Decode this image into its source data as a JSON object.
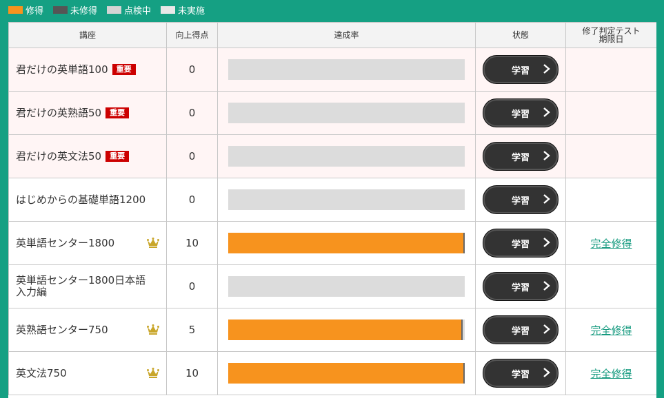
{
  "legend": [
    {
      "label": "修得",
      "color": "#f7931e"
    },
    {
      "label": "未修得",
      "color": "#555555"
    },
    {
      "label": "点検中",
      "color": "#d4d4d4"
    },
    {
      "label": "未実施",
      "color": "#e8e8e8"
    }
  ],
  "table": {
    "headers": {
      "course": "講座",
      "score": "向上得点",
      "progress": "達成率",
      "status": "状態",
      "test_line1": "修了判定テスト",
      "test_line2": "期限日"
    },
    "rows": [
      {
        "course": "君だけの英単語100",
        "badge": "重要",
        "score": "0",
        "progress": 0,
        "button": "学習",
        "test_status": ""
      },
      {
        "course": "君だけの英熟語50",
        "badge": "重要",
        "score": "0",
        "progress": 0,
        "button": "学習",
        "test_status": ""
      },
      {
        "course": "君だけの英文法50",
        "badge": "重要",
        "score": "0",
        "progress": 0,
        "button": "学習",
        "test_status": ""
      },
      {
        "course": "はじめからの基礎単語1200",
        "badge": "",
        "score": "0",
        "progress": 0,
        "button": "学習",
        "test_status": ""
      },
      {
        "course": "英単語センター1800",
        "badge": "",
        "crown": true,
        "score": "10",
        "progress": 100,
        "button": "学習",
        "test_status": "完全修得"
      },
      {
        "course": "英単語センター1800日本語入力編",
        "badge": "",
        "score": "0",
        "progress": 0,
        "button": "学習",
        "test_status": ""
      },
      {
        "course": "英熟語センター750",
        "badge": "",
        "crown": true,
        "score": "5",
        "progress": 99,
        "button": "学習",
        "test_status": "完全修得"
      },
      {
        "course": "英文法750",
        "badge": "",
        "crown": true,
        "score": "10",
        "progress": 100,
        "button": "学習",
        "test_status": "完全修得"
      }
    ]
  }
}
